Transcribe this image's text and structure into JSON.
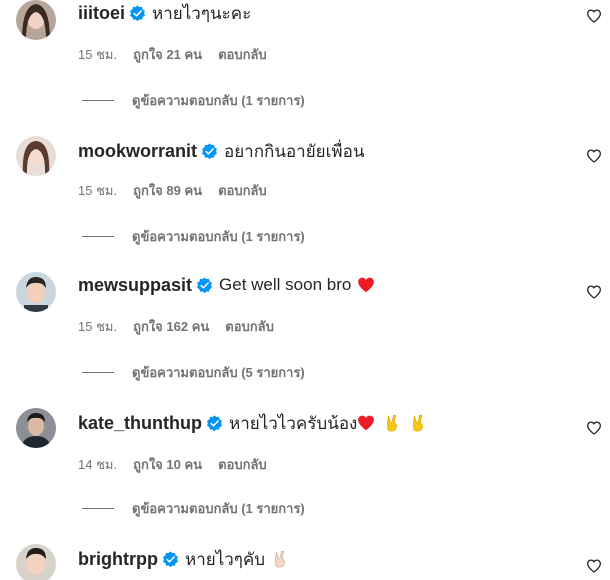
{
  "comments": [
    {
      "username": "iiitoei",
      "text": "หายไวๆนะคะ",
      "time": "15 ชม.",
      "likes": "ถูกใจ 21 คน",
      "reply": "ตอบกลับ",
      "view_replies": "ดูข้อความตอบกลับ (1 รายการ)",
      "emojis": []
    },
    {
      "username": "mookworranit",
      "text": "อยากกินอายัยเพื่อน",
      "time": "15 ชม.",
      "likes": "ถูกใจ 89 คน",
      "reply": "ตอบกลับ",
      "view_replies": "ดูข้อความตอบกลับ (1 รายการ)",
      "emojis": []
    },
    {
      "username": "mewsuppasit",
      "text": "Get well soon bro",
      "time": "15 ชม.",
      "likes": "ถูกใจ 162 คน",
      "reply": "ตอบกลับ",
      "view_replies": "ดูข้อความตอบกลับ (5 รายการ)",
      "emojis": [
        "red-heart-emoji"
      ]
    },
    {
      "username": "kate_thunthup",
      "text": "หายไวไวครับน้อง",
      "time": "14 ชม.",
      "likes": "ถูกใจ 10 คน",
      "reply": "ตอบกลับ",
      "view_replies": "ดูข้อความตอบกลับ (1 รายการ)",
      "emojis": [
        "red-heart-emoji",
        "victory-hand-emoji",
        "victory-hand-emoji"
      ]
    },
    {
      "username": "brightrpp",
      "text": "หายไวๆคับ",
      "emojis": [
        "victory-hand-light-emoji"
      ]
    }
  ],
  "icons": {
    "verified": "verified-badge-icon",
    "like": "heart-outline-icon"
  },
  "colors": {
    "verified_blue": "#0095f6",
    "secondary_text": "#737373",
    "primary_text": "#262626",
    "heart_red": "#ed1c24",
    "emoji_yellow": "#f5c518"
  }
}
